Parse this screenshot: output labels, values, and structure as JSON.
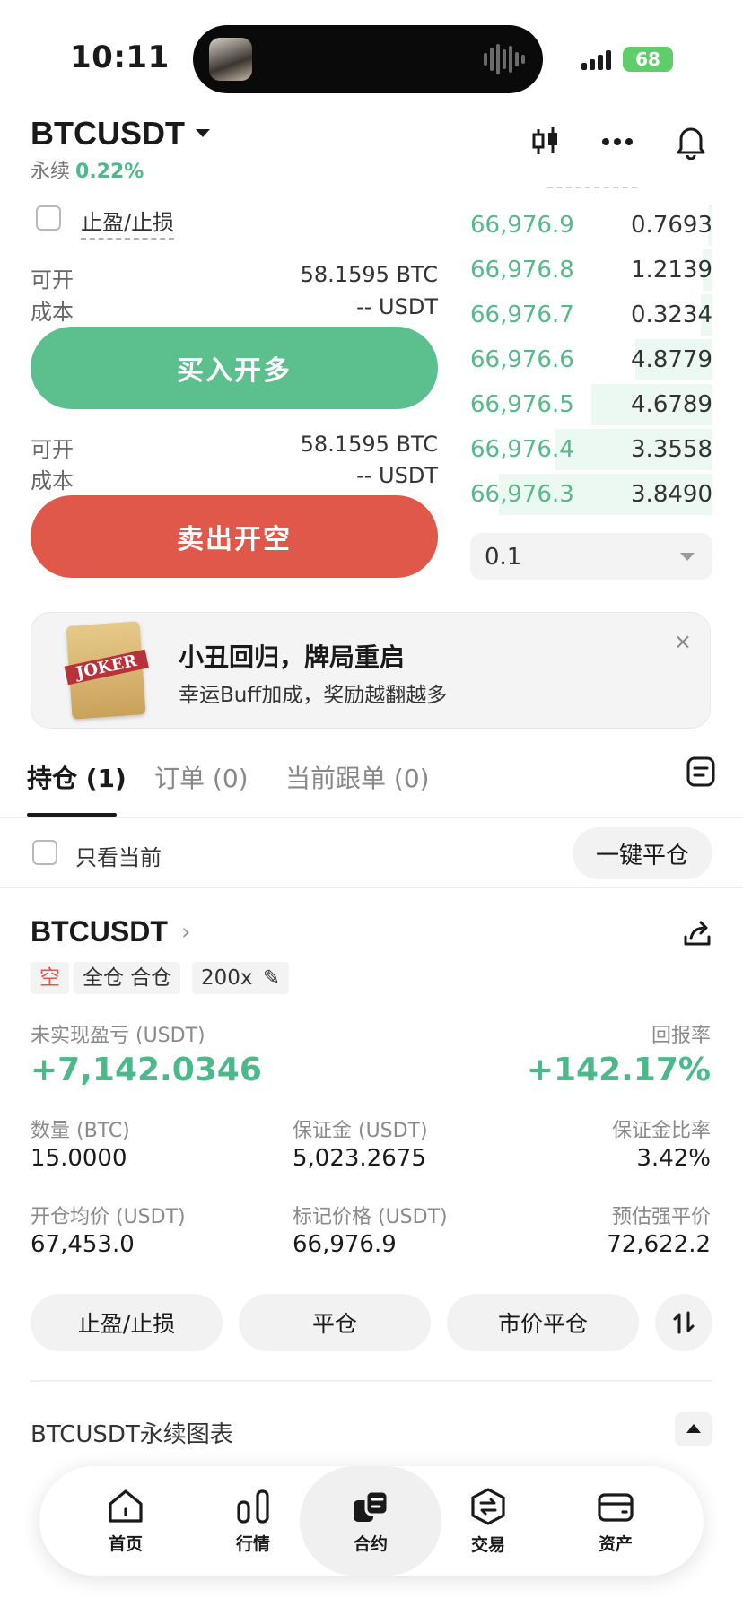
{
  "status_bar": {
    "time": "10:11",
    "battery": "68"
  },
  "header": {
    "symbol": "BTCUSDT",
    "perpetual_label": "永续",
    "change_pct": "0.22%",
    "icons": [
      "candlestick-icon",
      "more-icon",
      "bell-icon"
    ]
  },
  "order_panel": {
    "tpsl_label": "止盈/止损",
    "buy_block": {
      "available_label": "可开",
      "available_value": "58.1595 BTC",
      "cost_label": "成本",
      "cost_value": "-- USDT",
      "button": "买入开多"
    },
    "sell_block": {
      "available_label": "可开",
      "available_value": "58.1595 BTC",
      "cost_label": "成本",
      "cost_value": "-- USDT",
      "button": "卖出开空"
    }
  },
  "order_book": {
    "bids": [
      {
        "price": "66,976.9",
        "qty": "0.7693",
        "depth": 0.02
      },
      {
        "price": "66,976.8",
        "qty": "1.2139",
        "depth": 0.04
      },
      {
        "price": "66,976.7",
        "qty": "0.3234",
        "depth": 0.05
      },
      {
        "price": "66,976.6",
        "qty": "4.8779",
        "depth": 0.32
      },
      {
        "price": "66,976.5",
        "qty": "4.6789",
        "depth": 0.5
      },
      {
        "price": "66,976.4",
        "qty": "3.3558",
        "depth": 0.65
      },
      {
        "price": "66,976.3",
        "qty": "3.8490",
        "depth": 0.88
      }
    ],
    "precision": "0.1"
  },
  "banner": {
    "card_text": "JOKER",
    "title": "小丑回归，牌局重启",
    "subtitle": "幸运Buff加成，奖励越翻越多",
    "close": "×"
  },
  "tabs": [
    {
      "label": "持仓 (1)",
      "active": true
    },
    {
      "label": "订单 (0)",
      "active": false
    },
    {
      "label": "当前跟单 (0)",
      "active": false
    }
  ],
  "filters": {
    "only_current": "只看当前",
    "close_all": "一键平仓"
  },
  "position": {
    "symbol": "BTCUSDT",
    "side": "空",
    "margin_mode": "全仓 合仓",
    "leverage": "200x",
    "pnl_label": "未实现盈亏 (USDT)",
    "pnl_value": "+7,142.0346",
    "roi_label": "回报率",
    "roi_value": "+142.17%",
    "qty_label": "数量 (BTC)",
    "qty_value": "15.0000",
    "margin_label": "保证金 (USDT)",
    "margin_value": "5,023.2675",
    "margin_ratio_label": "保证金比率",
    "margin_ratio_value": "3.42%",
    "entry_label": "开仓均价 (USDT)",
    "entry_value": "67,453.0",
    "mark_label": "标记价格 (USDT)",
    "mark_value": "66,976.9",
    "liq_label": "预估强平价",
    "liq_value": "72,622.2",
    "actions": {
      "tpsl": "止盈/止损",
      "close": "平仓",
      "market_close": "市价平仓"
    }
  },
  "chart_section": {
    "title": "BTCUSDT永续图表"
  },
  "bottom_nav": [
    {
      "label": "首页",
      "icon": "home-icon"
    },
    {
      "label": "行情",
      "icon": "market-icon"
    },
    {
      "label": "合约",
      "icon": "contract-icon",
      "active": true
    },
    {
      "label": "交易",
      "icon": "trade-icon"
    },
    {
      "label": "资产",
      "icon": "wallet-icon"
    }
  ],
  "colors": {
    "green": "#5cbf8e",
    "red": "#e0584a",
    "text": "#1a1a1a"
  }
}
